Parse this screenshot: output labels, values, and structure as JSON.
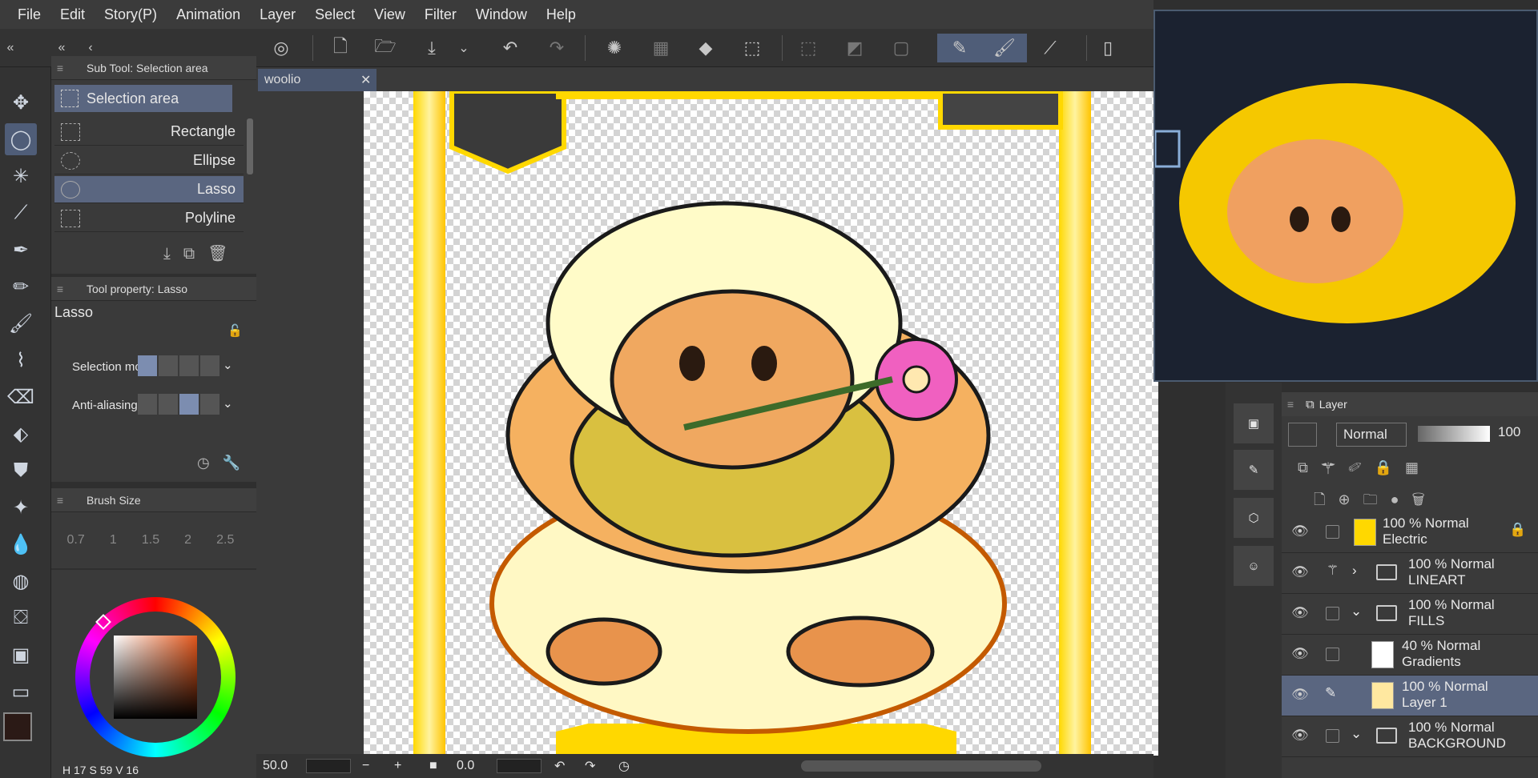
{
  "menu": [
    "File",
    "Edit",
    "Story(P)",
    "Animation",
    "Layer",
    "Select",
    "View",
    "Filter",
    "Window",
    "Help"
  ],
  "subtool_panel": {
    "title": "Sub Tool: Selection area",
    "group": "Selection area",
    "items": [
      "Rectangle",
      "Ellipse",
      "Lasso",
      "Polyline"
    ]
  },
  "tool_property": {
    "title": "Tool property: Lasso",
    "tool_name": "Lasso",
    "selection_mode_label": "Selection mo",
    "antialiasing_label": "Anti-aliasing"
  },
  "brush_size": {
    "title": "Brush Size",
    "values": [
      "0.7",
      "1",
      "1.5",
      "2",
      "2.5"
    ]
  },
  "color": {
    "hsv": {
      "h_label": "H",
      "h": "17",
      "s_label": "S",
      "s": "59",
      "v_label": "V",
      "v": "16"
    },
    "main_color": "#2b1a16",
    "sub_color": "#f7a0c8"
  },
  "document_tab": "woolio",
  "statusbar": {
    "zoom": "50.0",
    "rotation": "0.0"
  },
  "layer_panel": {
    "tab": "Layer",
    "blend_mode": "Normal",
    "opacity": "100",
    "layers": [
      {
        "line1": "100 % Normal",
        "line2": "Electric",
        "kind": "raster"
      },
      {
        "line1": "100 % Normal",
        "line2": "LINEART",
        "kind": "folder"
      },
      {
        "line1": "100 % Normal",
        "line2": "FILLS",
        "kind": "folder"
      },
      {
        "line1": "40 % Normal",
        "line2": "Gradients",
        "kind": "raster"
      },
      {
        "line1": "100 % Normal",
        "line2": "Layer 1",
        "kind": "raster",
        "selected": true
      },
      {
        "line1": "100 % Normal",
        "line2": "BACKGROUND",
        "kind": "folder"
      }
    ]
  },
  "accent": "#4f5d78"
}
